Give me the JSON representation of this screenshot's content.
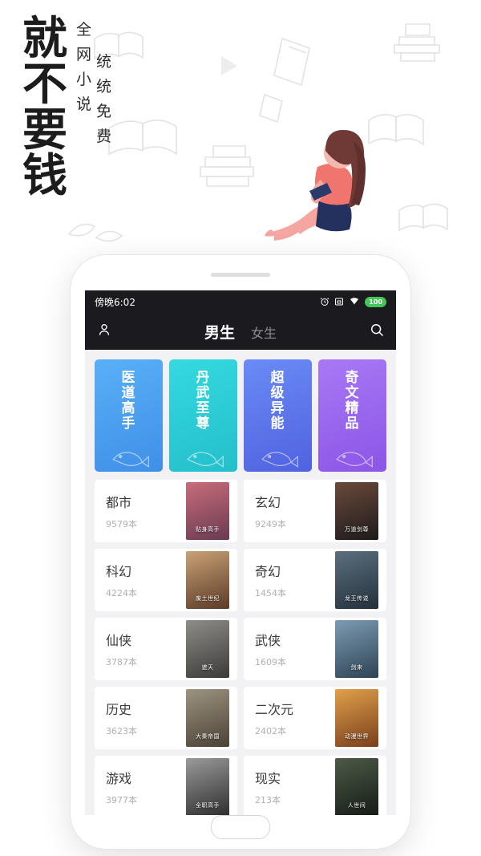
{
  "promo": {
    "headline_chars": [
      "就",
      "不",
      "要",
      "钱"
    ],
    "sub_col_1": [
      "全",
      "网",
      "小",
      "说"
    ],
    "sub_col_2": [
      "统",
      "统",
      "免",
      "费"
    ]
  },
  "phone": {
    "statusbar": {
      "time": "傍晚6:02",
      "icons": [
        "alarm-icon",
        "screenshot-icon",
        "wifi-icon"
      ],
      "battery": "100"
    },
    "topnav": {
      "profile_icon": "person-icon",
      "search_icon": "search-icon",
      "tabs": [
        {
          "label": "男生",
          "active": true
        },
        {
          "label": "女生",
          "active": false
        }
      ]
    },
    "banners": [
      {
        "title_chars": [
          "医",
          "道",
          "高",
          "手"
        ],
        "color_start": "#4fa7f5",
        "color_end": "#3f8fe8"
      },
      {
        "title_chars": [
          "丹",
          "武",
          "至",
          "尊"
        ],
        "color_start": "#2ed1d8",
        "color_end": "#24c0cc"
      },
      {
        "title_chars": [
          "超",
          "级",
          "异",
          "能"
        ],
        "color_start": "#5d7ef0",
        "color_end": "#5168e4"
      },
      {
        "title_chars": [
          "奇",
          "文",
          "精",
          "品"
        ],
        "color_start": "#9a6ef2",
        "color_end": "#8d5be8"
      }
    ],
    "categories": [
      {
        "name": "都市",
        "count": "9579本",
        "thumb_title": "贴身高手",
        "c1": "#c86d7a",
        "c2": "#6a3a52"
      },
      {
        "name": "玄幻",
        "count": "9249本",
        "thumb_title": "万道剑尊",
        "c1": "#6b4a3a",
        "c2": "#1d1a1c"
      },
      {
        "name": "科幻",
        "count": "4224本",
        "thumb_title": "废土世纪",
        "c1": "#caa276",
        "c2": "#5b3a28"
      },
      {
        "name": "奇幻",
        "count": "1454本",
        "thumb_title": "龙王传说",
        "c1": "#5c6f7e",
        "c2": "#23313c"
      },
      {
        "name": "仙侠",
        "count": "3787本",
        "thumb_title": "遮天",
        "c1": "#8e8d89",
        "c2": "#3c3a38"
      },
      {
        "name": "武侠",
        "count": "1609本",
        "thumb_title": "剑来",
        "c1": "#7c9bb2",
        "c2": "#2e4354"
      },
      {
        "name": "历史",
        "count": "3623本",
        "thumb_title": "大秦帝国",
        "c1": "#9d9380",
        "c2": "#4a4236"
      },
      {
        "name": "二次元",
        "count": "2402本",
        "thumb_title": "动漫世界",
        "c1": "#e0a04a",
        "c2": "#7a3f1c"
      },
      {
        "name": "游戏",
        "count": "3977本",
        "thumb_title": "全职高手",
        "c1": "#9a9a9a",
        "c2": "#2e2e2e"
      },
      {
        "name": "现实",
        "count": "213本",
        "thumb_title": "人世间",
        "c1": "#4c5a46",
        "c2": "#151c16"
      }
    ]
  }
}
